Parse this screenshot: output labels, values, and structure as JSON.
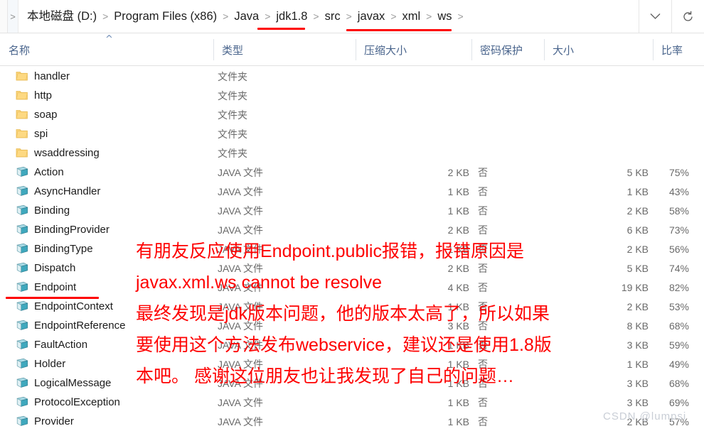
{
  "window": {
    "title": "本地磁盘 (D:) > Program Files (x86) > Java > jdk1.8 > src > javax > xml > ws"
  },
  "addressbar": {
    "back_chevron": ">",
    "separator": ">",
    "crumbs": [
      {
        "label": "本地磁盘 (D:)"
      },
      {
        "label": "Program Files (x86)"
      },
      {
        "label": "Java"
      },
      {
        "label": "jdk1.8"
      },
      {
        "label": "src"
      },
      {
        "label": "javax"
      },
      {
        "label": "xml"
      },
      {
        "label": "ws"
      }
    ],
    "dropdown_icon": "chevron-down-icon",
    "refresh_icon": "refresh-icon"
  },
  "columns": {
    "sort_caret": "^",
    "headers": [
      {
        "key": "name",
        "label": "名称"
      },
      {
        "key": "type",
        "label": "类型"
      },
      {
        "key": "csize",
        "label": "压缩大小"
      },
      {
        "key": "password",
        "label": "密码保护"
      },
      {
        "key": "size",
        "label": "大小"
      },
      {
        "key": "ratio",
        "label": "比率"
      }
    ]
  },
  "files": [
    {
      "name": "handler",
      "icon": "folder-icon",
      "type": "文件夹",
      "csize": "",
      "password": "",
      "size": "",
      "ratio": ""
    },
    {
      "name": "http",
      "icon": "folder-icon",
      "type": "文件夹",
      "csize": "",
      "password": "",
      "size": "",
      "ratio": ""
    },
    {
      "name": "soap",
      "icon": "folder-icon",
      "type": "文件夹",
      "csize": "",
      "password": "",
      "size": "",
      "ratio": ""
    },
    {
      "name": "spi",
      "icon": "folder-icon",
      "type": "文件夹",
      "csize": "",
      "password": "",
      "size": "",
      "ratio": ""
    },
    {
      "name": "wsaddressing",
      "icon": "folder-icon",
      "type": "文件夹",
      "csize": "",
      "password": "",
      "size": "",
      "ratio": ""
    },
    {
      "name": "Action",
      "icon": "java-file-icon",
      "type": "JAVA 文件",
      "csize": "2 KB",
      "password": "否",
      "size": "5 KB",
      "ratio": "75%"
    },
    {
      "name": "AsyncHandler",
      "icon": "java-file-icon",
      "type": "JAVA 文件",
      "csize": "1 KB",
      "password": "否",
      "size": "1 KB",
      "ratio": "43%"
    },
    {
      "name": "Binding",
      "icon": "java-file-icon",
      "type": "JAVA 文件",
      "csize": "1 KB",
      "password": "否",
      "size": "2 KB",
      "ratio": "58%"
    },
    {
      "name": "BindingProvider",
      "icon": "java-file-icon",
      "type": "JAVA 文件",
      "csize": "2 KB",
      "password": "否",
      "size": "6 KB",
      "ratio": "73%"
    },
    {
      "name": "BindingType",
      "icon": "java-file-icon",
      "type": "JAVA 文件",
      "csize": "1 KB",
      "password": "否",
      "size": "2 KB",
      "ratio": "56%"
    },
    {
      "name": "Dispatch",
      "icon": "java-file-icon",
      "type": "JAVA 文件",
      "csize": "2 KB",
      "password": "否",
      "size": "5 KB",
      "ratio": "74%"
    },
    {
      "name": "Endpoint",
      "icon": "java-file-icon",
      "type": "JAVA 文件",
      "csize": "4 KB",
      "password": "否",
      "size": "19 KB",
      "ratio": "82%"
    },
    {
      "name": "EndpointContext",
      "icon": "java-file-icon",
      "type": "JAVA 文件",
      "csize": "1 KB",
      "password": "否",
      "size": "2 KB",
      "ratio": "53%"
    },
    {
      "name": "EndpointReference",
      "icon": "java-file-icon",
      "type": "JAVA 文件",
      "csize": "3 KB",
      "password": "否",
      "size": "8 KB",
      "ratio": "68%"
    },
    {
      "name": "FaultAction",
      "icon": "java-file-icon",
      "type": "JAVA 文件",
      "csize": "1 KB",
      "password": "否",
      "size": "3 KB",
      "ratio": "59%"
    },
    {
      "name": "Holder",
      "icon": "java-file-icon",
      "type": "JAVA 文件",
      "csize": "1 KB",
      "password": "否",
      "size": "1 KB",
      "ratio": "49%"
    },
    {
      "name": "LogicalMessage",
      "icon": "java-file-icon",
      "type": "JAVA 文件",
      "csize": "1 KB",
      "password": "否",
      "size": "3 KB",
      "ratio": "68%"
    },
    {
      "name": "ProtocolException",
      "icon": "java-file-icon",
      "type": "JAVA 文件",
      "csize": "1 KB",
      "password": "否",
      "size": "3 KB",
      "ratio": "69%"
    },
    {
      "name": "Provider",
      "icon": "java-file-icon",
      "type": "JAVA 文件",
      "csize": "1 KB",
      "password": "否",
      "size": "2 KB",
      "ratio": "57%"
    }
  ],
  "annotation": {
    "color": "#fe0000",
    "lines": [
      "有朋友反应使用Endpoint.public报错，报错原因是",
      "javax.xml.ws cannot be resolve",
      "最终发现是jdk版本问题，他的版本太高了，所以如果",
      "要使用这个方法发布webservice，建议还是使用1.8版",
      "本吧。 感谢这位朋友也让我发现了自己的问题…"
    ],
    "underlines": [
      {
        "name": "jdk1.8-underline"
      },
      {
        "name": "javax-xml-ws-underline"
      },
      {
        "name": "endpoint-underline"
      }
    ]
  },
  "watermark": {
    "text": "CSDN @lumpsi"
  }
}
